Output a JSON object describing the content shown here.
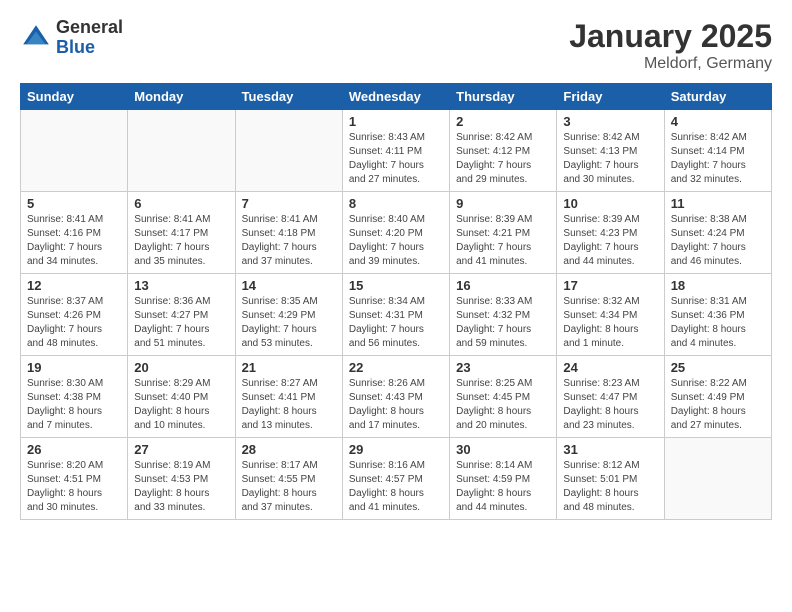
{
  "logo": {
    "general": "General",
    "blue": "Blue"
  },
  "title": "January 2025",
  "subtitle": "Meldorf, Germany",
  "weekdays": [
    "Sunday",
    "Monday",
    "Tuesday",
    "Wednesday",
    "Thursday",
    "Friday",
    "Saturday"
  ],
  "weeks": [
    [
      {
        "day": "",
        "sunrise": "",
        "sunset": "",
        "daylight": ""
      },
      {
        "day": "",
        "sunrise": "",
        "sunset": "",
        "daylight": ""
      },
      {
        "day": "",
        "sunrise": "",
        "sunset": "",
        "daylight": ""
      },
      {
        "day": "1",
        "sunrise": "Sunrise: 8:43 AM",
        "sunset": "Sunset: 4:11 PM",
        "daylight": "Daylight: 7 hours and 27 minutes."
      },
      {
        "day": "2",
        "sunrise": "Sunrise: 8:42 AM",
        "sunset": "Sunset: 4:12 PM",
        "daylight": "Daylight: 7 hours and 29 minutes."
      },
      {
        "day": "3",
        "sunrise": "Sunrise: 8:42 AM",
        "sunset": "Sunset: 4:13 PM",
        "daylight": "Daylight: 7 hours and 30 minutes."
      },
      {
        "day": "4",
        "sunrise": "Sunrise: 8:42 AM",
        "sunset": "Sunset: 4:14 PM",
        "daylight": "Daylight: 7 hours and 32 minutes."
      }
    ],
    [
      {
        "day": "5",
        "sunrise": "Sunrise: 8:41 AM",
        "sunset": "Sunset: 4:16 PM",
        "daylight": "Daylight: 7 hours and 34 minutes."
      },
      {
        "day": "6",
        "sunrise": "Sunrise: 8:41 AM",
        "sunset": "Sunset: 4:17 PM",
        "daylight": "Daylight: 7 hours and 35 minutes."
      },
      {
        "day": "7",
        "sunrise": "Sunrise: 8:41 AM",
        "sunset": "Sunset: 4:18 PM",
        "daylight": "Daylight: 7 hours and 37 minutes."
      },
      {
        "day": "8",
        "sunrise": "Sunrise: 8:40 AM",
        "sunset": "Sunset: 4:20 PM",
        "daylight": "Daylight: 7 hours and 39 minutes."
      },
      {
        "day": "9",
        "sunrise": "Sunrise: 8:39 AM",
        "sunset": "Sunset: 4:21 PM",
        "daylight": "Daylight: 7 hours and 41 minutes."
      },
      {
        "day": "10",
        "sunrise": "Sunrise: 8:39 AM",
        "sunset": "Sunset: 4:23 PM",
        "daylight": "Daylight: 7 hours and 44 minutes."
      },
      {
        "day": "11",
        "sunrise": "Sunrise: 8:38 AM",
        "sunset": "Sunset: 4:24 PM",
        "daylight": "Daylight: 7 hours and 46 minutes."
      }
    ],
    [
      {
        "day": "12",
        "sunrise": "Sunrise: 8:37 AM",
        "sunset": "Sunset: 4:26 PM",
        "daylight": "Daylight: 7 hours and 48 minutes."
      },
      {
        "day": "13",
        "sunrise": "Sunrise: 8:36 AM",
        "sunset": "Sunset: 4:27 PM",
        "daylight": "Daylight: 7 hours and 51 minutes."
      },
      {
        "day": "14",
        "sunrise": "Sunrise: 8:35 AM",
        "sunset": "Sunset: 4:29 PM",
        "daylight": "Daylight: 7 hours and 53 minutes."
      },
      {
        "day": "15",
        "sunrise": "Sunrise: 8:34 AM",
        "sunset": "Sunset: 4:31 PM",
        "daylight": "Daylight: 7 hours and 56 minutes."
      },
      {
        "day": "16",
        "sunrise": "Sunrise: 8:33 AM",
        "sunset": "Sunset: 4:32 PM",
        "daylight": "Daylight: 7 hours and 59 minutes."
      },
      {
        "day": "17",
        "sunrise": "Sunrise: 8:32 AM",
        "sunset": "Sunset: 4:34 PM",
        "daylight": "Daylight: 8 hours and 1 minute."
      },
      {
        "day": "18",
        "sunrise": "Sunrise: 8:31 AM",
        "sunset": "Sunset: 4:36 PM",
        "daylight": "Daylight: 8 hours and 4 minutes."
      }
    ],
    [
      {
        "day": "19",
        "sunrise": "Sunrise: 8:30 AM",
        "sunset": "Sunset: 4:38 PM",
        "daylight": "Daylight: 8 hours and 7 minutes."
      },
      {
        "day": "20",
        "sunrise": "Sunrise: 8:29 AM",
        "sunset": "Sunset: 4:40 PM",
        "daylight": "Daylight: 8 hours and 10 minutes."
      },
      {
        "day": "21",
        "sunrise": "Sunrise: 8:27 AM",
        "sunset": "Sunset: 4:41 PM",
        "daylight": "Daylight: 8 hours and 13 minutes."
      },
      {
        "day": "22",
        "sunrise": "Sunrise: 8:26 AM",
        "sunset": "Sunset: 4:43 PM",
        "daylight": "Daylight: 8 hours and 17 minutes."
      },
      {
        "day": "23",
        "sunrise": "Sunrise: 8:25 AM",
        "sunset": "Sunset: 4:45 PM",
        "daylight": "Daylight: 8 hours and 20 minutes."
      },
      {
        "day": "24",
        "sunrise": "Sunrise: 8:23 AM",
        "sunset": "Sunset: 4:47 PM",
        "daylight": "Daylight: 8 hours and 23 minutes."
      },
      {
        "day": "25",
        "sunrise": "Sunrise: 8:22 AM",
        "sunset": "Sunset: 4:49 PM",
        "daylight": "Daylight: 8 hours and 27 minutes."
      }
    ],
    [
      {
        "day": "26",
        "sunrise": "Sunrise: 8:20 AM",
        "sunset": "Sunset: 4:51 PM",
        "daylight": "Daylight: 8 hours and 30 minutes."
      },
      {
        "day": "27",
        "sunrise": "Sunrise: 8:19 AM",
        "sunset": "Sunset: 4:53 PM",
        "daylight": "Daylight: 8 hours and 33 minutes."
      },
      {
        "day": "28",
        "sunrise": "Sunrise: 8:17 AM",
        "sunset": "Sunset: 4:55 PM",
        "daylight": "Daylight: 8 hours and 37 minutes."
      },
      {
        "day": "29",
        "sunrise": "Sunrise: 8:16 AM",
        "sunset": "Sunset: 4:57 PM",
        "daylight": "Daylight: 8 hours and 41 minutes."
      },
      {
        "day": "30",
        "sunrise": "Sunrise: 8:14 AM",
        "sunset": "Sunset: 4:59 PM",
        "daylight": "Daylight: 8 hours and 44 minutes."
      },
      {
        "day": "31",
        "sunrise": "Sunrise: 8:12 AM",
        "sunset": "Sunset: 5:01 PM",
        "daylight": "Daylight: 8 hours and 48 minutes."
      },
      {
        "day": "",
        "sunrise": "",
        "sunset": "",
        "daylight": ""
      }
    ]
  ]
}
